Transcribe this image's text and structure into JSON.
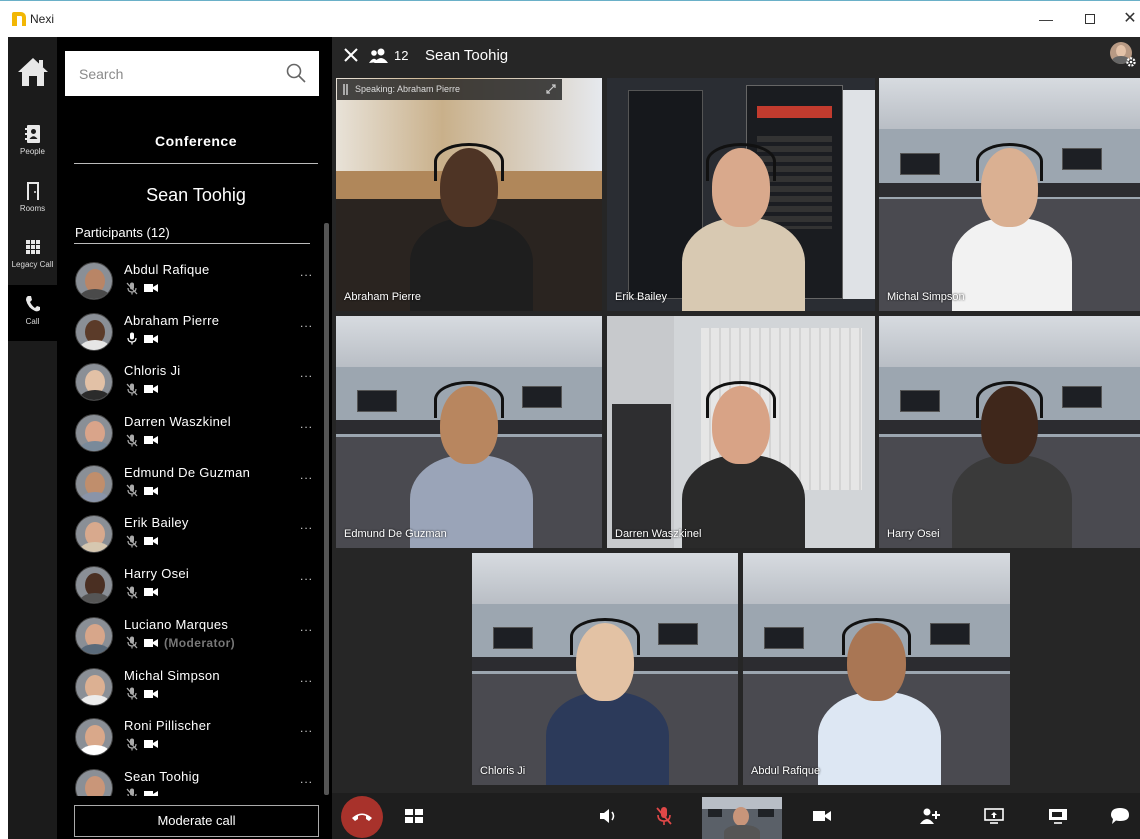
{
  "window": {
    "title": "Nexi"
  },
  "rail": {
    "items": [
      {
        "label": "People"
      },
      {
        "label": "Rooms"
      },
      {
        "label": "Legacy Call"
      },
      {
        "label": "Call"
      }
    ]
  },
  "search": {
    "placeholder": "Search"
  },
  "conference": {
    "heading": "Conference",
    "name": "Sean Toohig",
    "participants_heading": "Participants (12)",
    "participants": [
      {
        "name": "Abdul Rafique",
        "mic": "muted",
        "role": "",
        "skin": "#b98566",
        "shirt": "#4a4a4a"
      },
      {
        "name": "Abraham Pierre",
        "mic": "on",
        "role": "",
        "skin": "#5b3b29",
        "shirt": "#e6e6e6"
      },
      {
        "name": "Chloris Ji",
        "mic": "muted",
        "role": "",
        "skin": "#e2c1a6",
        "shirt": "#2b2b2b"
      },
      {
        "name": "Darren Waszkinel",
        "mic": "muted",
        "role": "",
        "skin": "#d9a48a",
        "shirt": "#7a8a9a"
      },
      {
        "name": "Edmund De Guzman",
        "mic": "muted",
        "role": "",
        "skin": "#c08e6c",
        "shirt": "#8a94a8"
      },
      {
        "name": "Erik Bailey",
        "mic": "muted",
        "role": "",
        "skin": "#d8a98d",
        "shirt": "#d6c7b0"
      },
      {
        "name": "Harry Osei",
        "mic": "muted",
        "role": "",
        "skin": "#4a2f22",
        "shirt": "#555555"
      },
      {
        "name": "Luciano Marques",
        "mic": "muted",
        "role": "(Moderator)",
        "skin": "#d7a68a",
        "shirt": "#5a6a7a"
      },
      {
        "name": "Michal Simpson",
        "mic": "muted",
        "role": "",
        "skin": "#dcb092",
        "shirt": "#ececec"
      },
      {
        "name": "Roni Pillischer",
        "mic": "muted",
        "role": "",
        "skin": "#d9a88a",
        "shirt": "#ffffff"
      },
      {
        "name": "Sean Toohig",
        "mic": "muted",
        "role": "",
        "skin": "#c99679",
        "shirt": "#6b6b6b"
      }
    ],
    "more": "...",
    "moderate_label": "Moderate call"
  },
  "call": {
    "participant_count": "12",
    "title": "Sean Toohig",
    "speaking_label": "Speaking: Abraham Pierre",
    "tiles": [
      {
        "name": "Abraham Pierre",
        "skin": "#4e3425",
        "shirt": "#1e1e1e",
        "scene": "cafe"
      },
      {
        "name": "Erik Bailey",
        "skin": "#d9a98c",
        "shirt": "#d8c9b2",
        "scene": "server"
      },
      {
        "name": "Michal Simpson",
        "skin": "#dab092",
        "shirt": "#f2f2f2",
        "scene": "office"
      },
      {
        "name": "Edmund De Guzman",
        "skin": "#b8865f",
        "shirt": "#9aa4b8",
        "scene": "office"
      },
      {
        "name": "Darren Waszkinel",
        "skin": "#d8a386",
        "shirt": "#2a2a2a",
        "scene": "room"
      },
      {
        "name": "Harry Osei",
        "skin": "#3f271b",
        "shirt": "#3a3a3a",
        "scene": "office"
      },
      {
        "name": "Chloris Ji",
        "skin": "#e3c2a4",
        "shirt": "#2c3a5a",
        "scene": "office"
      },
      {
        "name": "Abdul Rafique",
        "skin": "#a97654",
        "shirt": "#dde7f3",
        "scene": "office"
      }
    ]
  }
}
